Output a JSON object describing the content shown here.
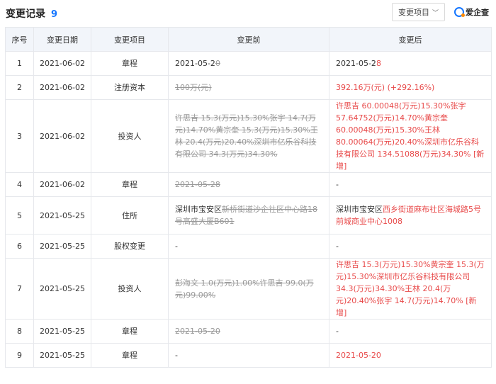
{
  "header": {
    "title": "变更记录",
    "count": "9",
    "filter_label": "变更项目",
    "brand_name": "爱企查"
  },
  "table": {
    "columns": [
      "序号",
      "变更日期",
      "变更项目",
      "变更前",
      "变更后"
    ],
    "rows": [
      {
        "no": "1",
        "date": "2021-06-02",
        "item": "章程",
        "before_plain": "2021-05-2",
        "before_strike": "0",
        "after_plain": "2021-05-2",
        "after_red": "8"
      },
      {
        "no": "2",
        "date": "2021-06-02",
        "item": "注册资本",
        "before_strike": "100万(元)",
        "after_red": "392.16万(元) (+292.16%)"
      },
      {
        "no": "3",
        "date": "2021-06-02",
        "item": "投资人",
        "before_strike": "许思吉 15.3(万元)15.30%张宇 14.7(万元)14.70%黄宗奎 15.3(万元)15.30%王林 20.4(万元)20.40%深圳市亿乐谷科技有限公司 34.3(万元)34.30%",
        "after_red": "许思吉 60.00048(万元)15.30%张宇 57.64752(万元)14.70%黄宗奎 60.00048(万元)15.30%王林 80.00064(万元)20.40%深圳市亿乐谷科技有限公司 134.51088(万元)34.30% [新增]"
      },
      {
        "no": "4",
        "date": "2021-06-02",
        "item": "章程",
        "before_strike": "2021-05-28",
        "after_plain": "-"
      },
      {
        "no": "5",
        "date": "2021-05-25",
        "item": "住所",
        "before_plain": "深圳市宝安区",
        "before_strike": "新桥街道沙企社区中心路18号高盛大厦B601",
        "after_plain": "深圳市宝安区",
        "after_red": "西乡街道麻布社区海城路5号前城商业中心1008"
      },
      {
        "no": "6",
        "date": "2021-05-25",
        "item": "股权变更",
        "before_plain": "-",
        "after_plain": "-"
      },
      {
        "no": "7",
        "date": "2021-05-25",
        "item": "投资人",
        "before_strike": "彭海文 1.0(万元)1.00%许思吉 99.0(万元)99.00%",
        "after_red": "许思吉 15.3(万元)15.30%黄宗奎 15.3(万元)15.30%深圳市亿乐谷科技有限公司 34.3(万元)34.30%王林 20.4(万元)20.40%张宇 14.7(万元)14.70% [新增]"
      },
      {
        "no": "8",
        "date": "2021-05-25",
        "item": "章程",
        "before_strike": "2021-05-20",
        "after_plain": "-"
      },
      {
        "no": "9",
        "date": "2021-05-25",
        "item": "章程",
        "before_plain": "-",
        "after_red": "2021-05-20"
      }
    ]
  },
  "colors": {
    "accent": "#1677ff",
    "highlight": "#e84a4a",
    "header_bg": "#f2f5fa",
    "strike_text": "#999999"
  },
  "icons": {
    "filter_chevron": "chevron-down-icon",
    "brand_logo": "aiqicha-logo-icon"
  }
}
